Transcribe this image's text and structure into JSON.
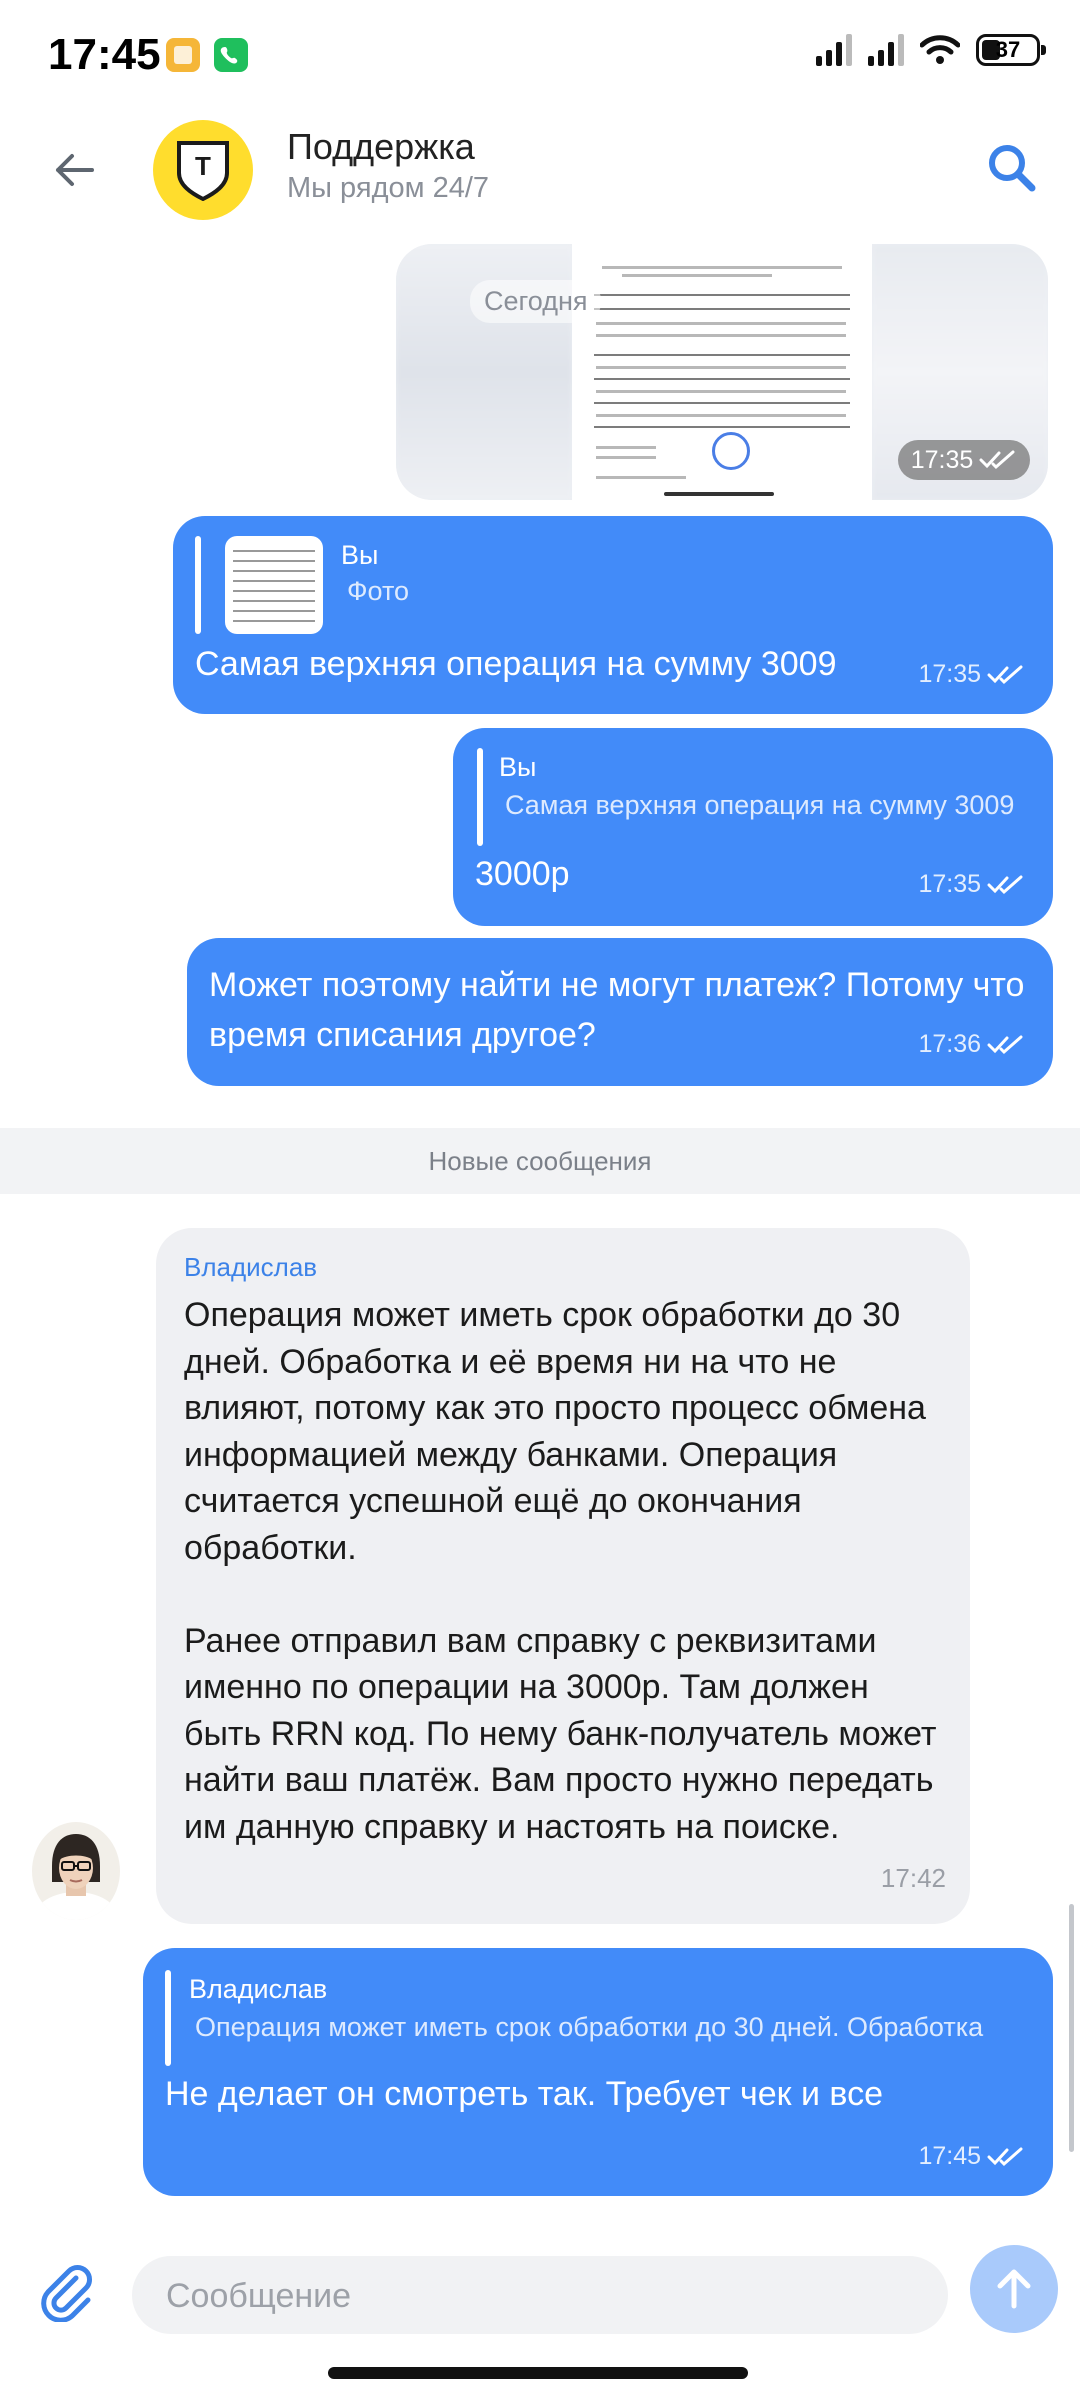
{
  "status_bar": {
    "time": "17:45",
    "battery": "37",
    "app_colors": [
      "#f5b638",
      "#1fbf5d"
    ]
  },
  "header": {
    "title": "Поддержка",
    "subtitle": "Мы рядом 24/7",
    "logo_letter": "Т",
    "accent": "#ffdd2d"
  },
  "messages": {
    "image": {
      "date_label": "Сегодня",
      "time": "17:35"
    },
    "m1": {
      "quote_author": "Вы",
      "quote_text": "Фото",
      "text": "Самая верхняя операция на сумму 3009",
      "time": "17:35"
    },
    "m2": {
      "quote_author": "Вы",
      "quote_text": "Самая верхняя операция на сумму 3009",
      "text": "3000р",
      "time": "17:35"
    },
    "m3": {
      "text": "Может поэтому найти не могут платеж? Потому что время списания другое?",
      "time": "17:36"
    },
    "divider": "Новые сообщения",
    "m4": {
      "author": "Владислав",
      "text": "Операция может иметь срок обработки до 30 дней. Обработка и её время ни на что не влияют, потому как это просто процесс обмена информацией между банками. Операция считается успешной ещё до окончания обработки.\n\nРанее отправил вам справку с реквизитами именно по операции на 3000р. Там должен быть RRN код. По нему банк-получатель может найти ваш платёж. Вам просто нужно передать им данную справку и настоять на поиске.",
      "time": "17:42"
    },
    "m5": {
      "quote_author": "Владислав",
      "quote_text": "Операция может иметь срок обработки до 30 дней. Обработка",
      "text": "Не делает он смотреть так. Требует чек и все",
      "time": "17:45"
    }
  },
  "composer": {
    "placeholder": "Сообщение"
  },
  "colors": {
    "outgoing": "#428bf9",
    "incoming": "#eff0f3",
    "link": "#3c82e8"
  }
}
